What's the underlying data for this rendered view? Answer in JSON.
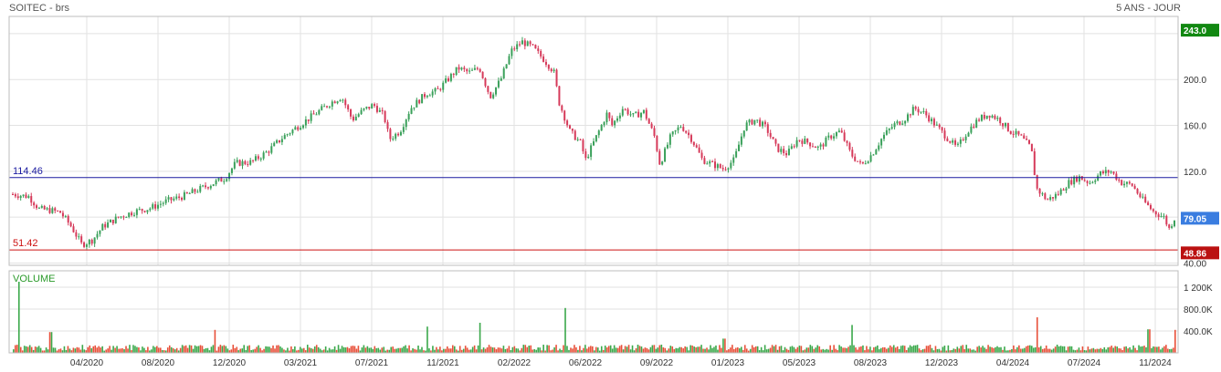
{
  "header": {
    "title": "SOITEC - brs",
    "period": "5 ANS - JOUR"
  },
  "colors": {
    "up": "#3aa05a",
    "down": "#d63a5a",
    "grid": "#e2e2e2",
    "frame": "#bdbdbd",
    "resistance": "#1a1aa0",
    "support": "#cc1111",
    "last_badge": "#3a7de0",
    "high_badge": "#118811",
    "low_badge": "#bb1111",
    "volume_label": "#2a9a2a"
  },
  "chart_data": {
    "type": "candlestick",
    "xaxis": {
      "tick_labels": [
        "04/2020",
        "08/2020",
        "12/2020",
        "03/2021",
        "07/2021",
        "11/2021",
        "02/2022",
        "06/2022",
        "09/2022",
        "01/2023",
        "05/2023",
        "08/2023",
        "12/2023",
        "04/2024",
        "07/2024",
        "11/2024"
      ]
    },
    "price": {
      "ylim": [
        38,
        255
      ],
      "tick_labels": [
        "40.00",
        "80.00",
        "120.0",
        "160.0",
        "200.0"
      ],
      "tick_values": [
        40,
        80,
        120,
        160,
        200
      ],
      "h_lines": [
        {
          "label": "114.46",
          "value": 114.46,
          "color": "resistance"
        },
        {
          "label": "51.42",
          "value": 51.42,
          "color": "support"
        }
      ],
      "badges": [
        {
          "label": "243.0",
          "value": 243.0,
          "color": "high_badge"
        },
        {
          "label": "79.05",
          "value": 79.05,
          "color": "last_badge"
        },
        {
          "label": "48.86",
          "value": 48.86,
          "color": "low_badge"
        }
      ],
      "trend": [
        [
          0,
          100
        ],
        [
          3,
          98
        ],
        [
          5,
          87
        ],
        [
          7,
          86
        ],
        [
          9,
          84
        ],
        [
          11,
          72
        ],
        [
          13,
          56
        ],
        [
          15,
          60
        ],
        [
          17,
          72
        ],
        [
          20,
          80
        ],
        [
          23,
          85
        ],
        [
          26,
          88
        ],
        [
          29,
          94
        ],
        [
          32,
          98
        ],
        [
          35,
          104
        ],
        [
          38,
          110
        ],
        [
          40,
          114
        ],
        [
          42,
          127
        ],
        [
          45,
          128
        ],
        [
          48,
          137
        ],
        [
          51,
          150
        ],
        [
          54,
          160
        ],
        [
          57,
          170
        ],
        [
          60,
          180
        ],
        [
          62,
          185
        ],
        [
          64,
          165
        ],
        [
          66,
          173
        ],
        [
          68,
          178
        ],
        [
          70,
          168
        ],
        [
          71,
          148
        ],
        [
          73,
          155
        ],
        [
          75,
          175
        ],
        [
          78,
          188
        ],
        [
          80,
          190
        ],
        [
          82,
          200
        ],
        [
          84,
          210
        ],
        [
          86,
          206
        ],
        [
          88,
          210
        ],
        [
          90,
          185
        ],
        [
          92,
          200
        ],
        [
          94,
          225
        ],
        [
          96,
          233
        ],
        [
          98,
          228
        ],
        [
          100,
          218
        ],
        [
          102,
          207
        ],
        [
          103,
          180
        ],
        [
          105,
          155
        ],
        [
          107,
          145
        ],
        [
          108,
          130
        ],
        [
          110,
          150
        ],
        [
          112,
          170
        ],
        [
          113,
          160
        ],
        [
          115,
          175
        ],
        [
          117,
          168
        ],
        [
          119,
          172
        ],
        [
          121,
          150
        ],
        [
          122,
          126
        ],
        [
          124,
          150
        ],
        [
          126,
          160
        ],
        [
          128,
          148
        ],
        [
          130,
          130
        ],
        [
          132,
          126
        ],
        [
          134,
          122
        ],
        [
          136,
          130
        ],
        [
          138,
          160
        ],
        [
          140,
          165
        ],
        [
          142,
          158
        ],
        [
          144,
          140
        ],
        [
          146,
          135
        ],
        [
          148,
          148
        ],
        [
          150,
          145
        ],
        [
          152,
          140
        ],
        [
          154,
          150
        ],
        [
          156,
          155
        ],
        [
          158,
          135
        ],
        [
          160,
          125
        ],
        [
          162,
          135
        ],
        [
          164,
          150
        ],
        [
          166,
          160
        ],
        [
          168,
          165
        ],
        [
          170,
          175
        ],
        [
          172,
          170
        ],
        [
          174,
          160
        ],
        [
          176,
          150
        ],
        [
          178,
          140
        ],
        [
          180,
          155
        ],
        [
          182,
          165
        ],
        [
          184,
          170
        ],
        [
          186,
          165
        ],
        [
          188,
          155
        ],
        [
          190,
          150
        ],
        [
          192,
          140
        ],
        [
          193,
          105
        ],
        [
          195,
          95
        ],
        [
          197,
          100
        ],
        [
          199,
          110
        ],
        [
          201,
          115
        ],
        [
          203,
          110
        ],
        [
          205,
          118
        ],
        [
          207,
          120
        ],
        [
          209,
          110
        ],
        [
          211,
          108
        ],
        [
          213,
          95
        ],
        [
          215,
          85
        ],
        [
          217,
          80
        ],
        [
          218,
          70
        ],
        [
          219,
          79.05
        ]
      ]
    },
    "volume": {
      "label": "VOLUME",
      "ylim": [
        0,
        1500
      ],
      "tick_labels": [
        "400.0K",
        "800.0K",
        "1 200K"
      ],
      "tick_values": [
        400,
        800,
        1200
      ],
      "spikes": [
        [
          1,
          1300
        ],
        [
          7,
          380
        ],
        [
          38,
          420
        ],
        [
          78,
          480
        ],
        [
          88,
          550
        ],
        [
          104,
          820
        ],
        [
          134,
          260
        ],
        [
          158,
          510
        ],
        [
          193,
          650
        ],
        [
          214,
          430
        ],
        [
          219,
          420
        ]
      ]
    }
  }
}
